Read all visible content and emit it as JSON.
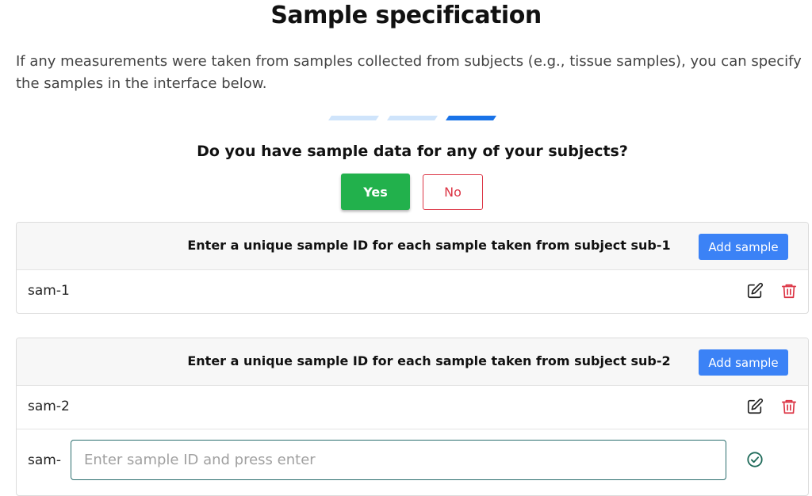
{
  "page": {
    "title": "Sample specification",
    "intro": "If any measurements were taken from samples collected from subjects (e.g., tissue samples), you can specify the samples in the interface below."
  },
  "progress": {
    "steps": 3,
    "current_step": 3
  },
  "question": {
    "text": "Do you have sample data for any of your subjects?",
    "yes_label": "Yes",
    "no_label": "No",
    "selected": "Yes"
  },
  "subjects": [
    {
      "header": "Enter a unique sample ID for each sample taken from subject sub-1",
      "add_label": "Add sample",
      "samples": [
        "sam-1"
      ]
    },
    {
      "header": "Enter a unique sample ID for each sample taken from subject sub-2",
      "add_label": "Add sample",
      "samples": [
        "sam-2"
      ],
      "new_entry": {
        "prefix": "sam-",
        "value": "",
        "placeholder": "Enter sample ID and press enter"
      }
    }
  ],
  "icons": {
    "edit": "edit-icon",
    "delete": "trash-icon",
    "confirm": "check-circle-icon"
  },
  "colors": {
    "yes": "#22b14c",
    "no": "#dc3545",
    "add": "#3b82f6",
    "progress_active": "#1a73e8",
    "progress_inactive": "#cfe4fb",
    "delete": "#dc3545",
    "confirm": "#1f6b5a"
  }
}
